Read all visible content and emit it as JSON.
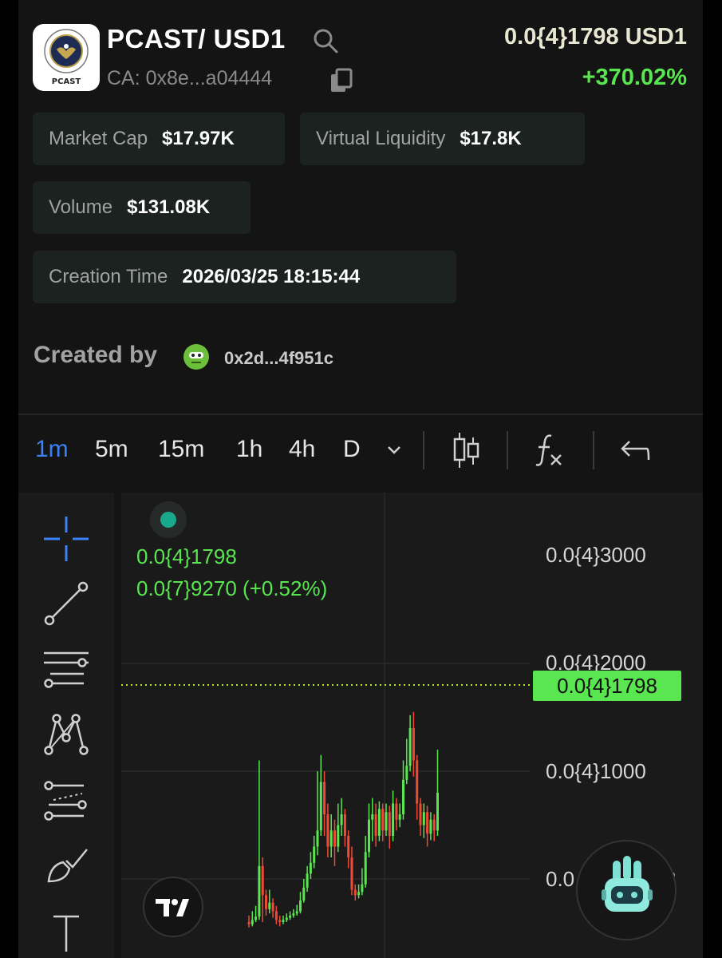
{
  "token": {
    "pair": "PCAST/ USD1",
    "logo_label": "PCAST",
    "contract": "CA: 0x8e...a04444",
    "price": "0.0{4}1798 USD1",
    "change": "+370.02%"
  },
  "stats": {
    "market_cap_label": "Market Cap",
    "market_cap_value": "$17.97K",
    "liquidity_label": "Virtual Liquidity",
    "liquidity_value": "$17.8K",
    "volume_label": "Volume",
    "volume_value": "$131.08K",
    "creation_label": "Creation Time",
    "creation_value": "2026/03/25 18:15:44"
  },
  "creator": {
    "label": "Created by",
    "address": "0x2d...4f951c"
  },
  "timeframes": [
    "1m",
    "5m",
    "15m",
    "1h",
    "4h",
    "D"
  ],
  "active_timeframe": "1m",
  "chart_legend": {
    "line1": "0.0{4}1798",
    "line2": "0.0{7}9270 (+0.52%)"
  },
  "chart_axis": {
    "labels": [
      "0.0{4}3000",
      "0.0{4}2000",
      "0.0{4}1000",
      "0.0"
    ],
    "current_price_tag": "0.0{4}1798",
    "partial_suffix": "3"
  },
  "colors": {
    "up": "#5ae650",
    "down": "#f04a37",
    "accent": "#3b82f6"
  },
  "chart_data": {
    "type": "candlestick",
    "y_unit": "price ×10^-4 USD1",
    "candles": [
      [
        0.6,
        0.58,
        0.66,
        0.55
      ],
      [
        0.58,
        0.62,
        0.7,
        0.56
      ],
      [
        0.62,
        0.65,
        0.75,
        0.6
      ],
      [
        0.65,
        1.12,
        2.1,
        0.62
      ],
      [
        1.12,
        0.85,
        1.2,
        0.6
      ],
      [
        0.85,
        0.72,
        0.9,
        0.66
      ],
      [
        0.72,
        0.78,
        0.9,
        0.68
      ],
      [
        0.78,
        0.7,
        0.82,
        0.64
      ],
      [
        0.7,
        0.62,
        0.75,
        0.58
      ],
      [
        0.62,
        0.6,
        0.66,
        0.56
      ],
      [
        0.6,
        0.62,
        0.66,
        0.58
      ],
      [
        0.62,
        0.64,
        0.68,
        0.6
      ],
      [
        0.64,
        0.66,
        0.7,
        0.62
      ],
      [
        0.66,
        0.68,
        0.72,
        0.64
      ],
      [
        0.68,
        0.7,
        0.76,
        0.66
      ],
      [
        0.7,
        0.8,
        0.88,
        0.68
      ],
      [
        0.8,
        0.92,
        1.0,
        0.78
      ],
      [
        0.92,
        1.05,
        1.12,
        0.88
      ],
      [
        1.05,
        1.15,
        1.25,
        1.0
      ],
      [
        1.15,
        1.3,
        1.4,
        1.1
      ],
      [
        1.3,
        1.45,
        2.0,
        1.22
      ],
      [
        1.45,
        1.9,
        2.15,
        1.4
      ],
      [
        1.9,
        1.6,
        2.0,
        1.4
      ],
      [
        1.6,
        1.3,
        1.7,
        1.2
      ],
      [
        1.3,
        1.45,
        1.6,
        1.2
      ],
      [
        1.45,
        1.3,
        1.55,
        1.12
      ],
      [
        1.3,
        1.5,
        1.7,
        1.25
      ],
      [
        1.5,
        1.6,
        1.75,
        1.4
      ],
      [
        1.6,
        1.4,
        1.65,
        1.3
      ],
      [
        1.4,
        1.2,
        1.45,
        1.1
      ],
      [
        1.2,
        0.9,
        1.3,
        0.85
      ],
      [
        0.9,
        0.85,
        0.95,
        0.8
      ],
      [
        0.85,
        0.88,
        0.95,
        0.82
      ],
      [
        0.88,
        0.95,
        1.1,
        0.85
      ],
      [
        0.95,
        1.25,
        1.4,
        0.92
      ],
      [
        1.25,
        1.55,
        1.7,
        1.2
      ],
      [
        1.55,
        1.6,
        1.75,
        1.35
      ],
      [
        1.6,
        1.4,
        1.7,
        1.3
      ],
      [
        1.4,
        1.65,
        1.72,
        1.35
      ],
      [
        1.65,
        1.45,
        1.7,
        1.35
      ],
      [
        1.45,
        1.62,
        1.7,
        1.4
      ],
      [
        1.62,
        1.4,
        1.68,
        1.28
      ],
      [
        1.4,
        1.7,
        1.82,
        1.35
      ],
      [
        1.7,
        1.55,
        1.75,
        1.45
      ],
      [
        1.55,
        1.6,
        1.7,
        1.48
      ],
      [
        1.6,
        1.92,
        2.1,
        1.55
      ],
      [
        1.92,
        2.05,
        2.3,
        1.88
      ],
      [
        2.05,
        2.4,
        2.52,
        2.0
      ],
      [
        2.4,
        2.1,
        2.55,
        1.95
      ],
      [
        2.1,
        1.7,
        2.15,
        1.55
      ],
      [
        1.7,
        1.5,
        1.75,
        1.4
      ],
      [
        1.5,
        1.62,
        1.7,
        1.38
      ],
      [
        1.62,
        1.42,
        1.68,
        1.3
      ],
      [
        1.42,
        1.55,
        1.62,
        1.36
      ],
      [
        1.55,
        1.45,
        1.6,
        1.35
      ],
      [
        1.45,
        1.8,
        2.2,
        1.4
      ]
    ],
    "ylim": [
      0,
      3.5
    ],
    "ticks": [
      1,
      2,
      3
    ],
    "current": 1.798
  }
}
